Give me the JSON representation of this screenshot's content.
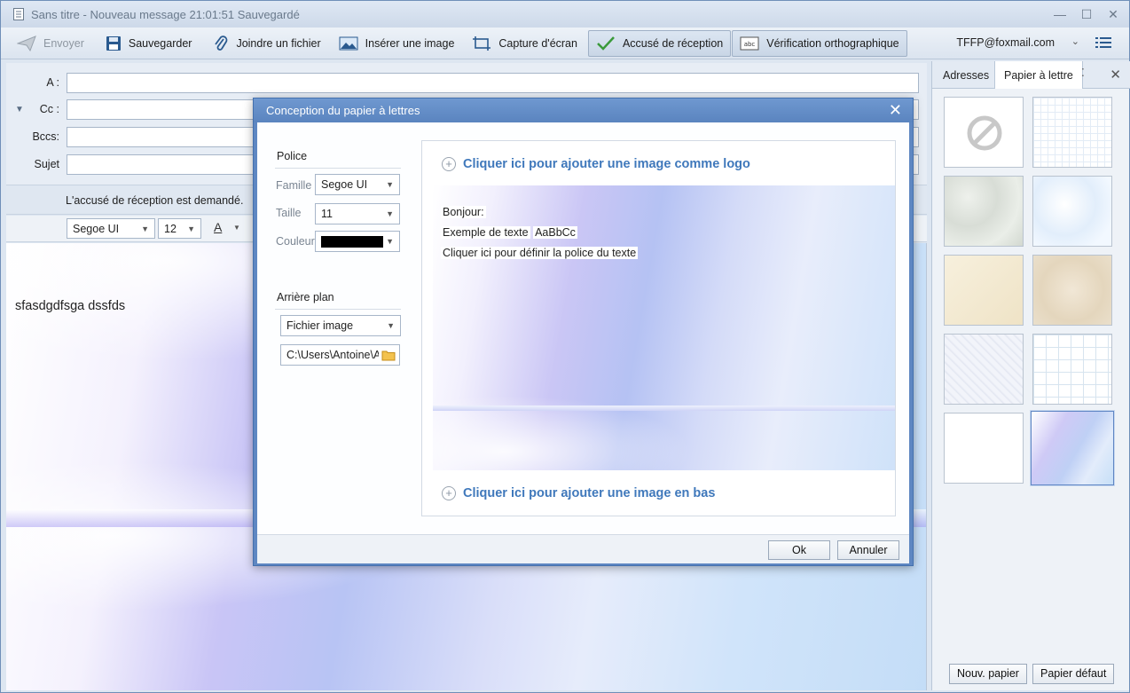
{
  "window": {
    "title": "Sans titre - Nouveau message   21:01:51 Sauvegardé"
  },
  "toolbar": {
    "send": "Envoyer",
    "save": "Sauvegarder",
    "attach": "Joindre un fichier",
    "insert_image": "Insérer une image",
    "screenshot": "Capture d'écran",
    "receipt": "Accusé de réception",
    "spellcheck": "Vérification orthographique",
    "account": "TFFP@foxmail.com"
  },
  "headers": {
    "to_label": "A :",
    "cc_label": "Cc :",
    "bcc_label": "Bccs:",
    "subject_label": "Sujet",
    "to_value": "",
    "cc_value": "",
    "bcc_value": "",
    "subject_value": ""
  },
  "receipt_notice": "L'accusé de réception est demandé.",
  "format": {
    "font": "Segoe UI",
    "size": "12"
  },
  "editor": {
    "body": "sfasdgdfsga dssfds"
  },
  "right_panel": {
    "tabs": [
      "Adresses",
      "Papier à lettre"
    ],
    "active_tab": "Papier à lettre",
    "new_paper": "Nouv. papier",
    "default_paper": "Papier défaut"
  },
  "dialog": {
    "title": "Conception du papier à lettres",
    "font_section": "Police",
    "family_label": "Famille",
    "family_value": "Segoe UI",
    "size_label": "Taille",
    "size_value": "11",
    "color_label": "Couleur",
    "color_value": "#000000",
    "background_section": "Arrière plan",
    "background_type": "Fichier image",
    "background_path": "C:\\Users\\Antoine\\A",
    "preview": {
      "add_logo": "Cliquer ici pour ajouter une image comme logo",
      "greeting": "Bonjour:",
      "sample_prefix": "Exemple de texte",
      "sample_value": "AaBbCc",
      "set_font": "Cliquer ici pour définir la police du texte",
      "add_bottom": "Cliquer ici pour ajouter une image en bas"
    },
    "ok": "Ok",
    "cancel": "Annuler"
  },
  "colors": {
    "accent": "#3f78bb",
    "dialog_frame": "#5e87c2"
  }
}
